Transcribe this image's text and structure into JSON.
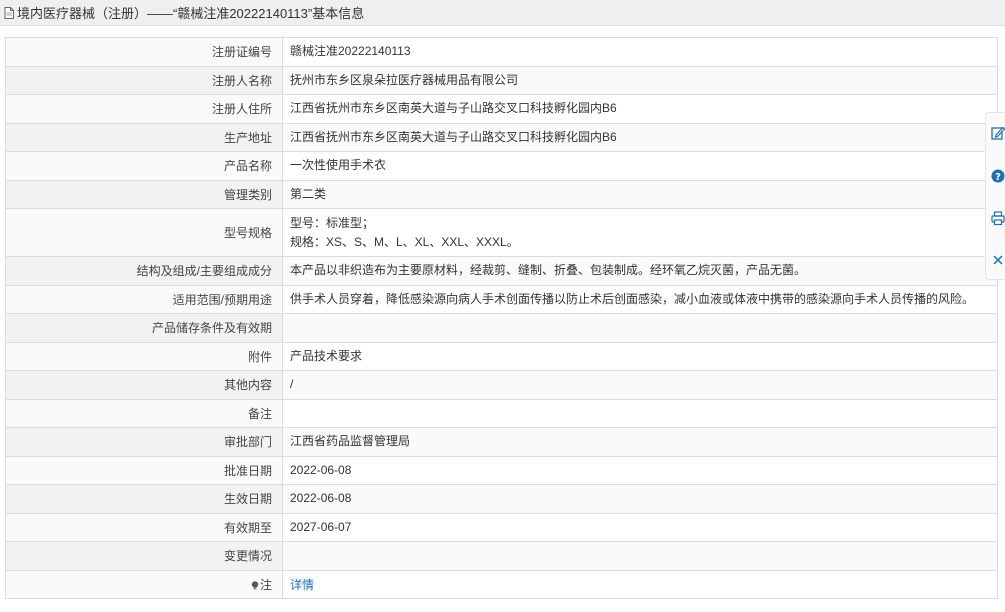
{
  "header": {
    "title": "境内医疗器械（注册）——“赣械注准20222140113”基本信息"
  },
  "rows": [
    {
      "label": "注册证编号",
      "values": [
        "赣械注准20222140113"
      ]
    },
    {
      "label": "注册人名称",
      "values": [
        "抚州市东乡区泉朵拉医疗器械用品有限公司"
      ]
    },
    {
      "label": "注册人住所",
      "values": [
        "江西省抚州市东乡区南英大道与子山路交叉口科技孵化园内B6"
      ]
    },
    {
      "label": "生产地址",
      "values": [
        "江西省抚州市东乡区南英大道与子山路交叉口科技孵化园内B6"
      ]
    },
    {
      "label": "产品名称",
      "values": [
        "一次性使用手术衣"
      ]
    },
    {
      "label": "管理类别",
      "values": [
        "第二类"
      ]
    },
    {
      "label": "型号规格",
      "values": [
        "型号：标准型；",
        "规格：XS、S、M、L、XL、XXL、XXXL。"
      ]
    },
    {
      "label": "结构及组成/主要组成成分",
      "values": [
        "本产品以非织造布为主要原材料，经裁剪、缝制、折叠、包装制成。经环氧乙烷灭菌，产品无菌。"
      ]
    },
    {
      "label": "适用范围/预期用途",
      "values": [
        "供手术人员穿着，降低感染源向病人手术创面传播以防止术后创面感染，减小血液或体液中携带的感染源向手术人员传播的风险。"
      ]
    },
    {
      "label": "产品储存条件及有效期",
      "values": [
        ""
      ]
    },
    {
      "label": "附件",
      "values": [
        "产品技术要求"
      ]
    },
    {
      "label": "其他内容",
      "values": [
        "/"
      ]
    },
    {
      "label": "备注",
      "values": [
        ""
      ]
    },
    {
      "label": "审批部门",
      "values": [
        "江西省药品监督管理局"
      ]
    },
    {
      "label": "批准日期",
      "values": [
        "2022-06-08"
      ]
    },
    {
      "label": "生效日期",
      "values": [
        "2022-06-08"
      ]
    },
    {
      "label": "有效期至",
      "values": [
        "2027-06-07"
      ]
    },
    {
      "label": "变更情况",
      "values": [
        ""
      ]
    }
  ],
  "note_row": {
    "label": "注",
    "link_text": "详情"
  },
  "side_toolbar": {
    "buttons": [
      {
        "name": "edit-icon"
      },
      {
        "name": "help-icon"
      },
      {
        "name": "print-icon"
      },
      {
        "name": "close-icon"
      }
    ]
  },
  "colors": {
    "link": "#1a6fc3",
    "icon_blue": "#1f6fb5",
    "border": "#dcdcdc",
    "title_bg": "#efefef"
  }
}
